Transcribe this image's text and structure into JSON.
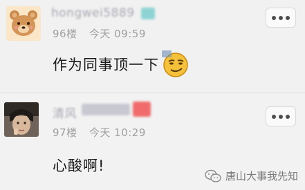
{
  "comments": [
    {
      "username": "hongwei5889",
      "likes": "96楼",
      "time": "今天 09:59",
      "text": "作为同事顶一下",
      "emoji": "smirk-emoji"
    },
    {
      "username": "清风",
      "likes": "97楼",
      "time": "今天 10:29",
      "text": "心酸啊!"
    }
  ],
  "menu_icon": "more-dots-icon",
  "watermark": {
    "text": "唐山大事我先知",
    "icon": "wechat-icon"
  },
  "colors": {
    "background": "#f1f1f1",
    "username": "#a9a9b4",
    "meta": "#a0a0a0",
    "text": "#1a1a1a"
  }
}
